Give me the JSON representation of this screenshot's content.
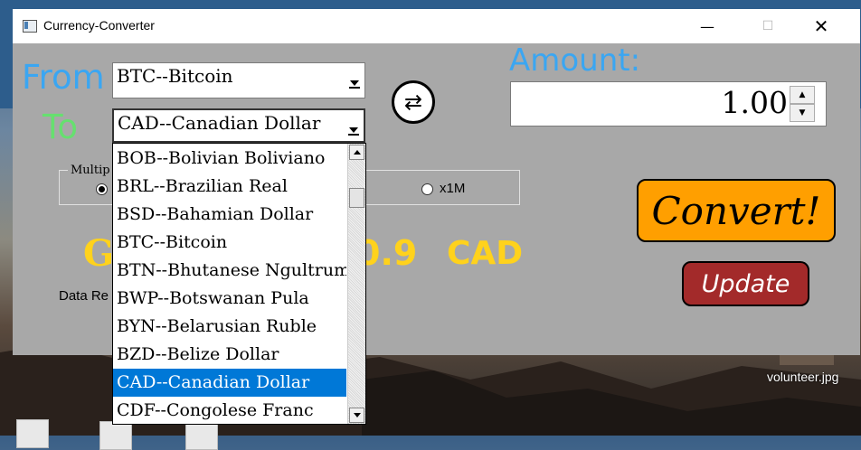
{
  "window": {
    "title": "Currency-Converter"
  },
  "labels": {
    "from": "From",
    "to": "To",
    "amount": "Amount:"
  },
  "from_currency": "BTC--Bitcoin",
  "to_currency": "CAD--Canadian Dollar",
  "amount_value": "1.00",
  "multiplier": {
    "title": "Multip",
    "options": [
      {
        "label": "x1M",
        "selected": false
      }
    ],
    "first_selected": true
  },
  "result": {
    "prefix": "G",
    "number": "0.9",
    "currency": "CAD"
  },
  "data_ref": "Data Re",
  "buttons": {
    "convert": "Convert!",
    "update": "Update",
    "swap_icon": "swap-arrows-icon"
  },
  "dropdown": {
    "items": [
      {
        "label": "BOB--Bolivian Boliviano",
        "selected": false
      },
      {
        "label": "BRL--Brazilian Real",
        "selected": false
      },
      {
        "label": "BSD--Bahamian Dollar",
        "selected": false
      },
      {
        "label": "BTC--Bitcoin",
        "selected": false
      },
      {
        "label": "BTN--Bhutanese Ngultrum",
        "selected": false
      },
      {
        "label": "BWP--Botswanan Pula",
        "selected": false
      },
      {
        "label": "BYN--Belarusian Ruble",
        "selected": false
      },
      {
        "label": "BZD--Belize Dollar",
        "selected": false
      },
      {
        "label": "CAD--Canadian Dollar",
        "selected": true
      },
      {
        "label": "CDF--Congolese Franc",
        "selected": false
      }
    ]
  },
  "desktop": {
    "file_label": "volunteer.jpg"
  },
  "colors": {
    "from": "#3aa6f2",
    "to": "#66e06f",
    "amount": "#3aa6f2",
    "result": "#ffd21c",
    "convert_bg": "#ff9f00",
    "update_bg": "#a32a2a",
    "selection": "#0078d7"
  }
}
